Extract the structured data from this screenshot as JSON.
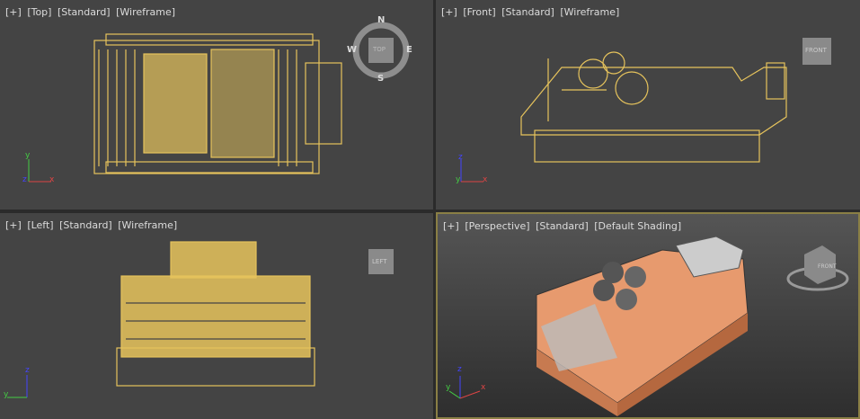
{
  "viewports": [
    {
      "id": "top",
      "labels": [
        "[+]",
        "[Top]",
        "[Standard]",
        "[Wireframe]"
      ],
      "cube": "TOP",
      "compass": [
        "N",
        "E",
        "S",
        "W"
      ]
    },
    {
      "id": "front",
      "labels": [
        "[+]",
        "[Front]",
        "[Standard]",
        "[Wireframe]"
      ],
      "cube": "FRONT"
    },
    {
      "id": "left",
      "labels": [
        "[+]",
        "[Left]",
        "[Standard]",
        "[Wireframe]"
      ],
      "cube": "LEFT"
    },
    {
      "id": "persp",
      "labels": [
        "[+]",
        "[Perspective]",
        "[Standard]",
        "[Default Shading]"
      ],
      "cube": "FRONT"
    }
  ],
  "axes": {
    "x": "x",
    "y": "y",
    "z": "z"
  },
  "colors": {
    "wire": "#e6c35c",
    "model": "#e79a6e",
    "active_border": "#8a7f45"
  }
}
